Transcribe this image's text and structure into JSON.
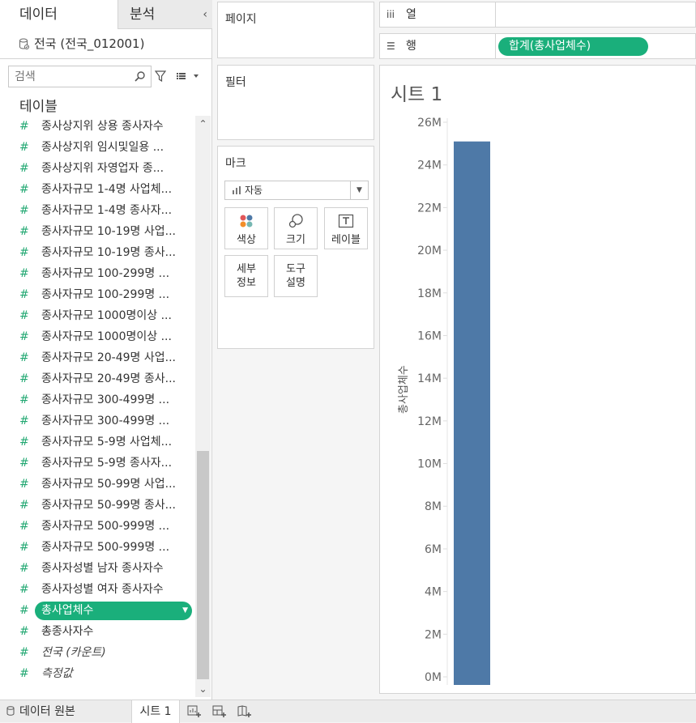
{
  "left_pane": {
    "tab_data": "데이터",
    "tab_analysis": "분석",
    "collapse": "‹",
    "datasource": "전국 (전국_012001)",
    "search_placeholder": "검색",
    "tables_heading": "테이블",
    "fields": [
      {
        "label": "종사상지위 상용 종사자수",
        "type": "measure"
      },
      {
        "label": "종사상지위 임시및일용 ...",
        "type": "measure"
      },
      {
        "label": "종사상지위 자영업자 종...",
        "type": "measure"
      },
      {
        "label": "종사자규모 1-4명 사업체...",
        "type": "measure"
      },
      {
        "label": "종사자규모 1-4명 종사자...",
        "type": "measure"
      },
      {
        "label": "종사자규모 10-19명 사업...",
        "type": "measure"
      },
      {
        "label": "종사자규모 10-19명 종사...",
        "type": "measure"
      },
      {
        "label": "종사자규모 100-299명 ...",
        "type": "measure"
      },
      {
        "label": "종사자규모 100-299명 ...",
        "type": "measure"
      },
      {
        "label": "종사자규모 1000명이상 ...",
        "type": "measure"
      },
      {
        "label": "종사자규모 1000명이상 ...",
        "type": "measure"
      },
      {
        "label": "종사자규모 20-49명 사업...",
        "type": "measure"
      },
      {
        "label": "종사자규모 20-49명 종사...",
        "type": "measure"
      },
      {
        "label": "종사자규모 300-499명 ...",
        "type": "measure"
      },
      {
        "label": "종사자규모 300-499명 ...",
        "type": "measure"
      },
      {
        "label": "종사자규모 5-9명 사업체...",
        "type": "measure"
      },
      {
        "label": "종사자규모 5-9명 종사자...",
        "type": "measure"
      },
      {
        "label": "종사자규모 50-99명 사업...",
        "type": "measure"
      },
      {
        "label": "종사자규모 50-99명 종사...",
        "type": "measure"
      },
      {
        "label": "종사자규모 500-999명 ...",
        "type": "measure"
      },
      {
        "label": "종사자규모 500-999명 ...",
        "type": "measure"
      },
      {
        "label": "종사자성별 남자 종사자수",
        "type": "measure"
      },
      {
        "label": "종사자성별 여자 종사자수",
        "type": "measure"
      },
      {
        "label": "총사업체수",
        "type": "measure",
        "selected": true
      },
      {
        "label": "총종사자수",
        "type": "measure"
      },
      {
        "label": "전국 (카운트)",
        "type": "measure",
        "italic": true
      },
      {
        "label": "측정값",
        "type": "measure",
        "italic": true
      }
    ]
  },
  "shelves": {
    "pages": "페이지",
    "filters": "필터",
    "marks": "마크",
    "mark_type": "자동",
    "mark_buttons": {
      "color": "색상",
      "size": "크기",
      "label": "레이블",
      "detail_1": "세부",
      "detail_2": "정보",
      "tooltip_1": "도구",
      "tooltip_2": "설명"
    },
    "columns_label": "열",
    "rows_label": "행",
    "rows_pill": "합계(총사업체수)"
  },
  "viz": {
    "sheet_title": "시트 1",
    "axis_title": "총사업체수"
  },
  "bottom_bar": {
    "datasource_tab": "데이터 원본",
    "sheet_tab": "시트 1"
  },
  "colors": {
    "bar": "#4e79a7",
    "pill": "#1aaf7b",
    "measure_icon": "#22a872"
  },
  "chart_data": {
    "type": "bar",
    "categories": [
      ""
    ],
    "values": [
      25100000
    ],
    "title": "시트 1",
    "xlabel": "",
    "ylabel": "총사업체수",
    "ylim": [
      0,
      26000000
    ],
    "yticks": [
      "0M",
      "2M",
      "4M",
      "6M",
      "8M",
      "10M",
      "12M",
      "14M",
      "16M",
      "18M",
      "20M",
      "22M",
      "24M",
      "26M"
    ],
    "grid": false
  }
}
